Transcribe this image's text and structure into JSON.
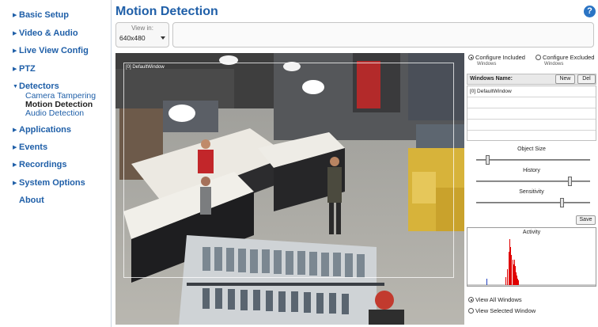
{
  "sidebar": {
    "items": [
      {
        "label": "Basic Setup"
      },
      {
        "label": "Video & Audio"
      },
      {
        "label": "Live View Config"
      },
      {
        "label": "PTZ"
      },
      {
        "label": "Detectors"
      },
      {
        "label": "Applications"
      },
      {
        "label": "Events"
      },
      {
        "label": "Recordings"
      },
      {
        "label": "System Options"
      },
      {
        "label": "About"
      }
    ],
    "detector_subitems": [
      {
        "label": "Camera Tampering"
      },
      {
        "label": "Motion Detection"
      },
      {
        "label": "Audio Detection"
      }
    ]
  },
  "header": {
    "title": "Motion Detection",
    "help": "?"
  },
  "view_in": {
    "label": "View in:",
    "value": "640x480"
  },
  "video": {
    "window_label": "[0] DefaultWindow"
  },
  "panel": {
    "configure_included": "Configure Included",
    "configure_included_sub": "Windows",
    "configure_excluded": "Configure Excluded",
    "configure_excluded_sub": "Windows",
    "windows_name_header": "Windows Name:",
    "new_label": "New",
    "del_label": "Del",
    "windows": [
      "[0] DefaultWindow"
    ],
    "object_size_label": "Object Size",
    "object_size_value": 0.1,
    "history_label": "History",
    "history_value": 0.82,
    "sensitivity_label": "Sensitivity",
    "sensitivity_value": 0.75,
    "save_label": "Save",
    "activity_label": "Activity",
    "view_all": "View All Windows",
    "view_selected": "View Selected Window"
  },
  "colors": {
    "link": "#1f5fa8",
    "activity_bar": "#e00000",
    "activity_marker": "#2040c0"
  }
}
